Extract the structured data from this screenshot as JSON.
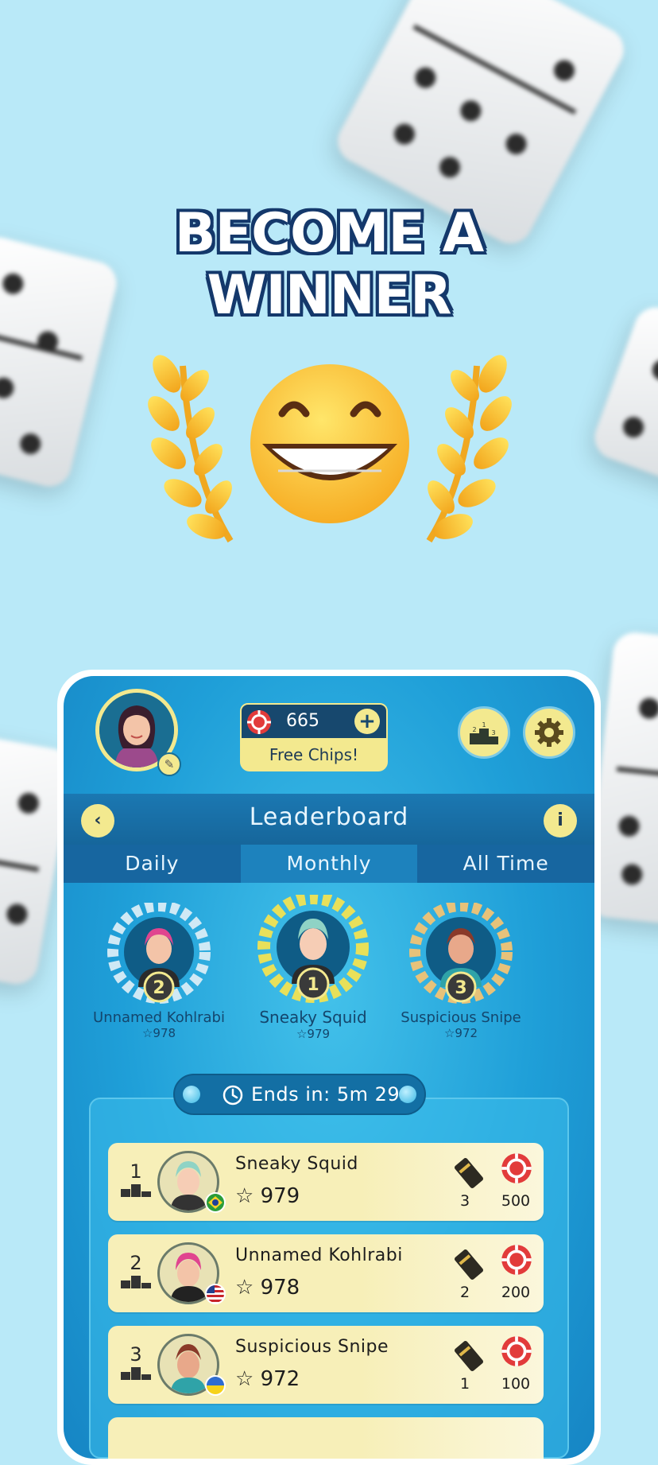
{
  "headline": {
    "line1": "BECOME A",
    "line2": "WINNER"
  },
  "colors": {
    "accent": "#f3e98f",
    "panel_blue": "#1f9fd8",
    "header_blue": "#16669b",
    "row_bg": "#f7efb8"
  },
  "topbar": {
    "chips_value": "665",
    "chips_add": "+",
    "free_chips_label": "Free Chips!"
  },
  "leaderboard": {
    "title": "Leaderboard",
    "back_icon": "‹",
    "info_icon": "i",
    "tabs": [
      {
        "label": "Daily"
      },
      {
        "label": "Monthly"
      },
      {
        "label": "All Time"
      }
    ],
    "active_tab": "Monthly",
    "podium": [
      {
        "rank": "2",
        "name": "Unnamed Kohlrabi",
        "score": "☆978"
      },
      {
        "rank": "1",
        "name": "Sneaky Squid",
        "score": "☆979"
      },
      {
        "rank": "3",
        "name": "Suspicious Snipe",
        "score": "☆972"
      }
    ],
    "timer": "Ends in: 5m 29s",
    "rows": [
      {
        "rank": "1",
        "name": "Sneaky Squid",
        "score": "☆ 979",
        "tickets": "3",
        "chips": "500",
        "flag": "brazil"
      },
      {
        "rank": "2",
        "name": "Unnamed Kohlrabi",
        "score": "☆ 978",
        "tickets": "2",
        "chips": "200",
        "flag": "usa"
      },
      {
        "rank": "3",
        "name": "Suspicious Snipe",
        "score": "☆ 972",
        "tickets": "1",
        "chips": "100",
        "flag": "ukraine"
      }
    ]
  }
}
